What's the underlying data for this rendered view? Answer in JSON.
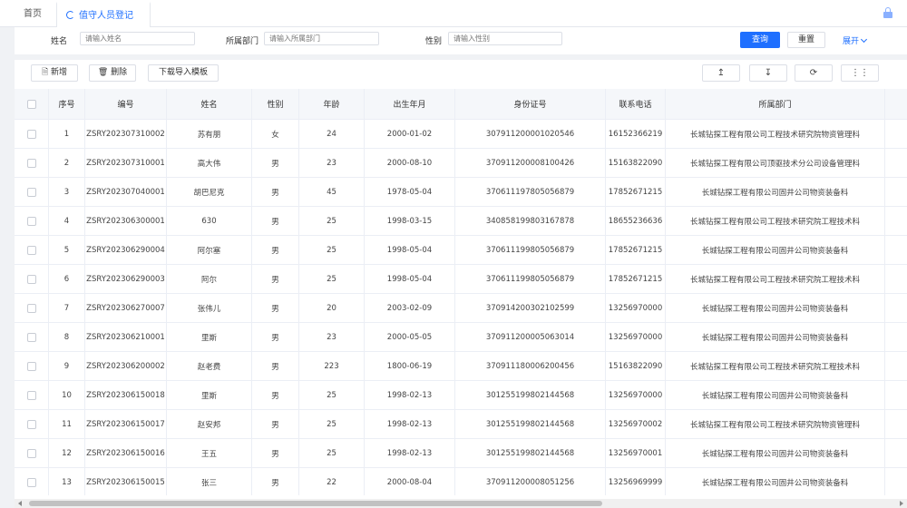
{
  "tabs": [
    {
      "label": "首页"
    },
    {
      "label": "值守人员登记",
      "close": "×"
    }
  ],
  "filters": {
    "name": {
      "label": "姓名",
      "placeholder": "请输入姓名"
    },
    "dept": {
      "label": "所属部门",
      "placeholder": "请输入所属部门"
    },
    "gender": {
      "label": "性别",
      "placeholder": "请输入性别"
    },
    "query_label": "查询",
    "reset_label": "重置",
    "expand_label": "展开"
  },
  "toolbar": {
    "add_label": "新增",
    "delete_label": "删除",
    "template_label": "下载导入模板",
    "icons": [
      "↥",
      "↧",
      "⟳",
      "⋮⋮"
    ]
  },
  "table": {
    "columns": [
      "序号",
      "编号",
      "姓名",
      "性别",
      "年龄",
      "出生年月",
      "身份证号",
      "联系电话",
      "所属部门"
    ],
    "rows": [
      [
        "1",
        "ZSRY202307310002",
        "苏有朋",
        "女",
        "24",
        "2000-01-02",
        "307911200001020546",
        "16152366219",
        "长城钻探工程有限公司工程技术研究院物资管理科"
      ],
      [
        "2",
        "ZSRY202307310001",
        "高大伟",
        "男",
        "23",
        "2000-08-10",
        "370911200008100426",
        "15163822090",
        "长城钻探工程有限公司顶驱技术分公司设备管理科"
      ],
      [
        "3",
        "ZSRY202307040001",
        "胡巴尼克",
        "男",
        "45",
        "1978-05-04",
        "370611197805056879",
        "17852671215",
        "长城钻探工程有限公司固井公司物资装备科"
      ],
      [
        "4",
        "ZSRY202306300001",
        "630",
        "男",
        "25",
        "1998-03-15",
        "340858199803167878",
        "18655236636",
        "长城钻探工程有限公司工程技术研究院工程技术科"
      ],
      [
        "5",
        "ZSRY202306290004",
        "阿尔塞",
        "男",
        "25",
        "1998-05-04",
        "370611199805056879",
        "17852671215",
        "长城钻探工程有限公司固井公司物资装备科"
      ],
      [
        "6",
        "ZSRY202306290003",
        "阿尔",
        "男",
        "25",
        "1998-05-04",
        "370611199805056879",
        "17852671215",
        "长城钻探工程有限公司工程技术研究院工程技术科"
      ],
      [
        "7",
        "ZSRY202306270007",
        "张伟儿",
        "男",
        "20",
        "2003-02-09",
        "370914200302102599",
        "13256970000",
        "长城钻探工程有限公司固井公司物资装备科"
      ],
      [
        "8",
        "ZSRY202306210001",
        "里斯",
        "男",
        "23",
        "2000-05-05",
        "370911200005063014",
        "13256970000",
        "长城钻探工程有限公司固井公司物资装备科"
      ],
      [
        "9",
        "ZSRY202306200002",
        "赵老费",
        "男",
        "223",
        "1800-06-19",
        "370911180006200456",
        "15163822090",
        "长城钻探工程有限公司工程技术研究院工程技术科"
      ],
      [
        "10",
        "ZSRY202306150018",
        "里斯",
        "男",
        "25",
        "1998-02-13",
        "301255199802144568",
        "13256970000",
        "长城钻探工程有限公司固井公司物资装备科"
      ],
      [
        "11",
        "ZSRY202306150017",
        "赵安邦",
        "男",
        "25",
        "1998-02-13",
        "301255199802144568",
        "13256970002",
        "长城钻探工程有限公司工程技术研究院物资管理科"
      ],
      [
        "12",
        "ZSRY202306150016",
        "王五",
        "男",
        "25",
        "1998-02-13",
        "301255199802144568",
        "13256970001",
        "长城钻探工程有限公司固井公司物资装备科"
      ],
      [
        "13",
        "ZSRY202306150015",
        "张三",
        "男",
        "22",
        "2000-08-04",
        "370911200008051256",
        "13256969999",
        "长城钻探工程有限公司固井公司物资装备科"
      ]
    ]
  },
  "colors": {
    "accent": "#1e6fff",
    "header_bg": "#f5f7fa",
    "border": "#ebeef5"
  }
}
